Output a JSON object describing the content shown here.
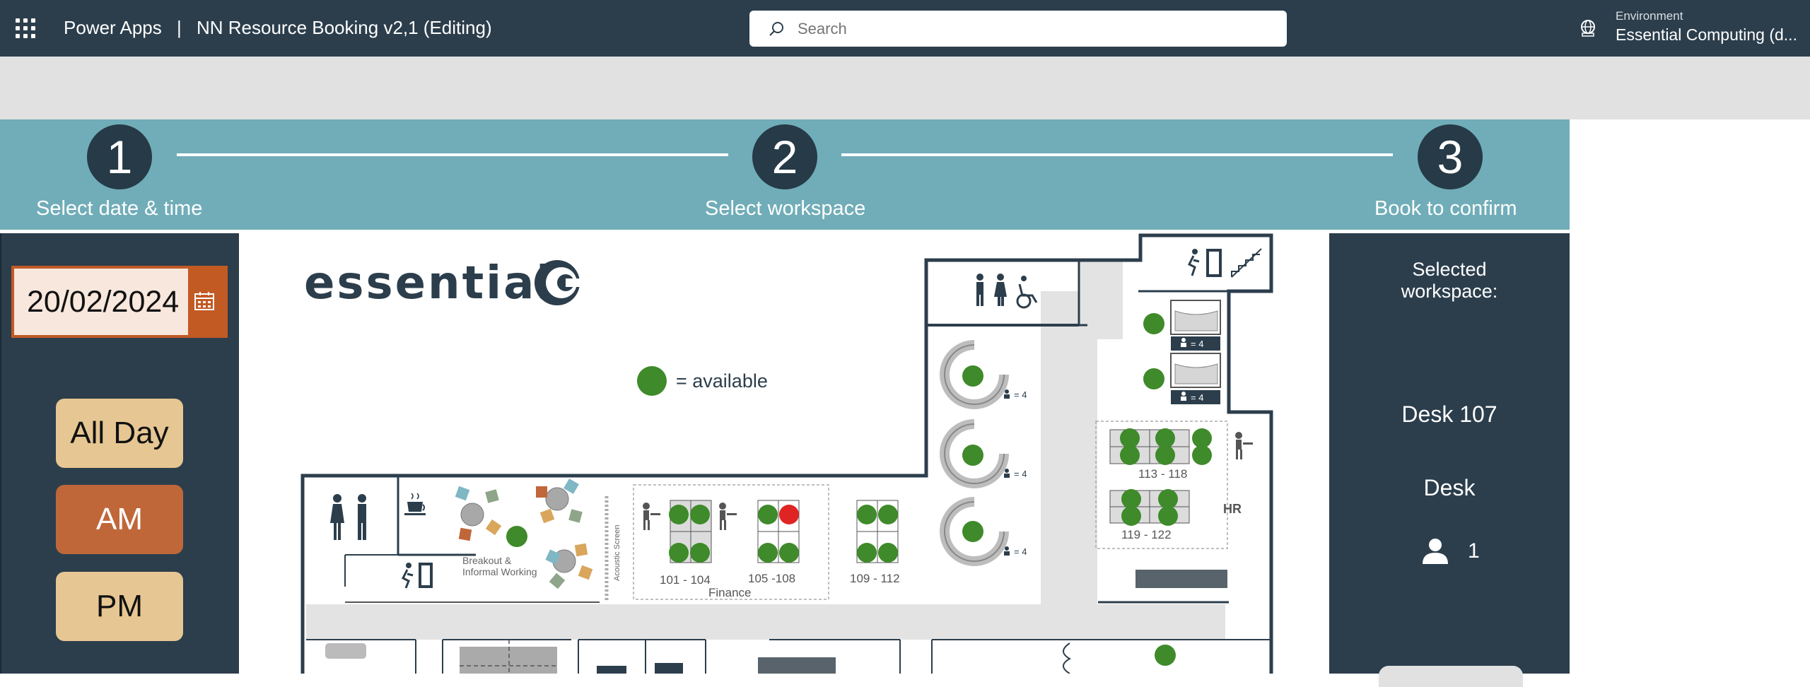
{
  "topbar": {
    "app_name": "Power Apps",
    "separator": "|",
    "doc_title": "NN Resource Booking v2,1 (Editing)",
    "search_placeholder": "Search",
    "environment_label": "Environment",
    "environment_name": "Essential Computing (d..."
  },
  "steps": [
    {
      "number": "1",
      "label": "Select date & time"
    },
    {
      "number": "2",
      "label": "Select workspace"
    },
    {
      "number": "3",
      "label": "Book to confirm"
    }
  ],
  "left_panel": {
    "date_value": "20/02/2024",
    "buttons": [
      {
        "label": "All Day",
        "state": "unselected"
      },
      {
        "label": "AM",
        "state": "selected"
      },
      {
        "label": "PM",
        "state": "unselected"
      }
    ]
  },
  "map": {
    "brand": "essential",
    "legend_text": "= available",
    "areas": {
      "finance": "Finance",
      "hr": "HR",
      "breakout": "Breakout &",
      "breakout_line2": "Informal Working",
      "acoustic": "Acoustic Screen"
    },
    "desk_groups": [
      "101 - 104",
      "105 -108",
      "109 - 112",
      "113 - 118",
      "119 - 122"
    ],
    "room_capacity": "= 4",
    "pod_capacity": "= 4"
  },
  "right_panel": {
    "title_line1": "Selected",
    "title_line2": "workspace:",
    "desk": "Desk 107",
    "type": "Desk",
    "count": "1"
  },
  "colors": {
    "topbar": "#2c3e4c",
    "banner": "#70adb8",
    "available": "#3f8a2a",
    "booked": "#e02424",
    "accent": "#c25a24"
  },
  "icons": [
    "app-launcher-icon",
    "search-icon",
    "environment-icon",
    "calendar-icon",
    "person-icon"
  ]
}
